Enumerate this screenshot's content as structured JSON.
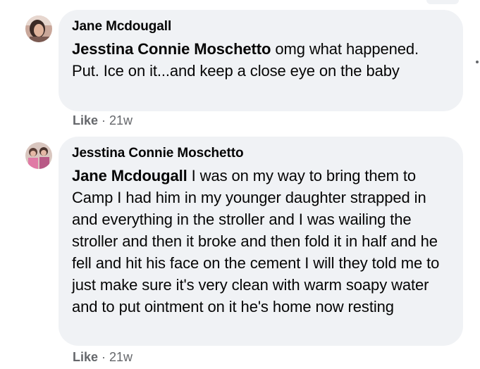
{
  "comments": [
    {
      "author": "Jane Mcdougall",
      "mention": "Jesstina Connie Moschetto",
      "text": " omg what happened. Put. Ice on it...and keep a close eye on the baby",
      "like_label": "Like",
      "separator": " · ",
      "time": "21w"
    },
    {
      "author": "Jesstina Connie Moschetto",
      "mention": "Jane Mcdougall",
      "text": " I was on my way to bring them to Camp I had him in my younger daughter strapped in and everything in the stroller and I was wailing the stroller and then it broke and then fold it in half and he fell and hit his face on the cement I will they told me to just make sure it's very clean with warm soapy water and to put ointment on it he's home now resting",
      "like_label": "Like",
      "separator": " · ",
      "time": "21w"
    }
  ],
  "colors": {
    "bubble": "#f0f2f5",
    "text": "#050505",
    "meta": "#65676b"
  }
}
